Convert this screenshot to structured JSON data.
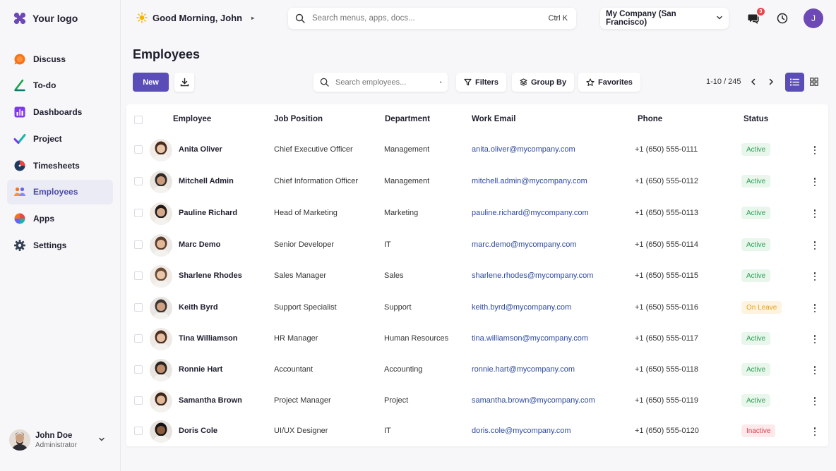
{
  "logo": {
    "text": "Your logo"
  },
  "sidebar": {
    "items": [
      {
        "label": "Discuss",
        "icon": "discuss-icon",
        "color": "#f97316"
      },
      {
        "label": "To-do",
        "icon": "todo-icon",
        "color": "#16a34a"
      },
      {
        "label": "Dashboards",
        "icon": "dashboards-icon",
        "color": "#7c3aed"
      },
      {
        "label": "Project",
        "icon": "project-icon",
        "color": "#14b8a6"
      },
      {
        "label": "Timesheets",
        "icon": "timesheets-icon",
        "color": "#1e3a5f"
      },
      {
        "label": "Employees",
        "icon": "employees-icon",
        "color": "#6366f1",
        "active": true
      },
      {
        "label": "Apps",
        "icon": "apps-icon",
        "color": "#ef4444"
      },
      {
        "label": "Settings",
        "icon": "gear-icon",
        "color": "#334155"
      }
    ],
    "user": {
      "name": "John Doe",
      "role": "Administrator"
    }
  },
  "topbar": {
    "greeting": "Good Morning, John",
    "search_placeholder": "Search menus, apps, docs...",
    "shortcut": "Ctrl K",
    "company": "My Company (San Francisco)",
    "message_badge": "3",
    "avatar_initial": "J"
  },
  "page": {
    "title": "Employees",
    "new_label": "New",
    "search_placeholder": "Search employees...",
    "filters_label": "Filters",
    "groupby_label": "Group By",
    "favorites_label": "Favorites",
    "pager": "1-10 / 245"
  },
  "table": {
    "headers": {
      "employee": "Employee",
      "job": "Job Position",
      "department": "Department",
      "email": "Work Email",
      "phone": "Phone",
      "status": "Status"
    },
    "rows": [
      {
        "name": "Anita Oliver",
        "job": "Chief Executive Officer",
        "department": "Management",
        "email": "anita.oliver@mycompany.com",
        "phone": "+1 (650) 555-0111",
        "status": "Active"
      },
      {
        "name": "Mitchell Admin",
        "job": "Chief Information Officer",
        "department": "Management",
        "email": "mitchell.admin@mycompany.com",
        "phone": "+1 (650) 555-0112",
        "status": "Active"
      },
      {
        "name": "Pauline Richard",
        "job": "Head of Marketing",
        "department": "Marketing",
        "email": "pauline.richard@mycompany.com",
        "phone": "+1 (650) 555-0113",
        "status": "Active"
      },
      {
        "name": "Marc Demo",
        "job": "Senior Developer",
        "department": "IT",
        "email": "marc.demo@mycompany.com",
        "phone": "+1 (650) 555-0114",
        "status": "Active"
      },
      {
        "name": "Sharlene Rhodes",
        "job": "Sales Manager",
        "department": "Sales",
        "email": "sharlene.rhodes@mycompany.com",
        "phone": "+1 (650) 555-0115",
        "status": "Active"
      },
      {
        "name": "Keith Byrd",
        "job": "Support Specialist",
        "department": "Support",
        "email": "keith.byrd@mycompany.com",
        "phone": "+1 (650) 555-0116",
        "status": "On Leave"
      },
      {
        "name": "Tina Williamson",
        "job": "HR Manager",
        "department": "Human Resources",
        "email": "tina.williamson@mycompany.com",
        "phone": "+1 (650) 555-0117",
        "status": "Active"
      },
      {
        "name": "Ronnie Hart",
        "job": "Accountant",
        "department": "Accounting",
        "email": "ronnie.hart@mycompany.com",
        "phone": "+1 (650) 555-0118",
        "status": "Active"
      },
      {
        "name": "Samantha Brown",
        "job": "Project Manager",
        "department": "Project",
        "email": "samantha.brown@mycompany.com",
        "phone": "+1 (650) 555-0119",
        "status": "Active"
      },
      {
        "name": "Doris Cole",
        "job": "UI/UX Designer",
        "department": "IT",
        "email": "doris.cole@mycompany.com",
        "phone": "+1 (650) 555-0120",
        "status": "Inactive"
      }
    ]
  },
  "status_colors": {
    "Active": {
      "bg": "#e8f6ec",
      "fg": "#2f9e55"
    },
    "On Leave": {
      "bg": "#fdf3e0",
      "fg": "#e3a21a"
    },
    "Inactive": {
      "bg": "#fde8ea",
      "fg": "#d9434f"
    }
  },
  "accent": "#5b4db8"
}
